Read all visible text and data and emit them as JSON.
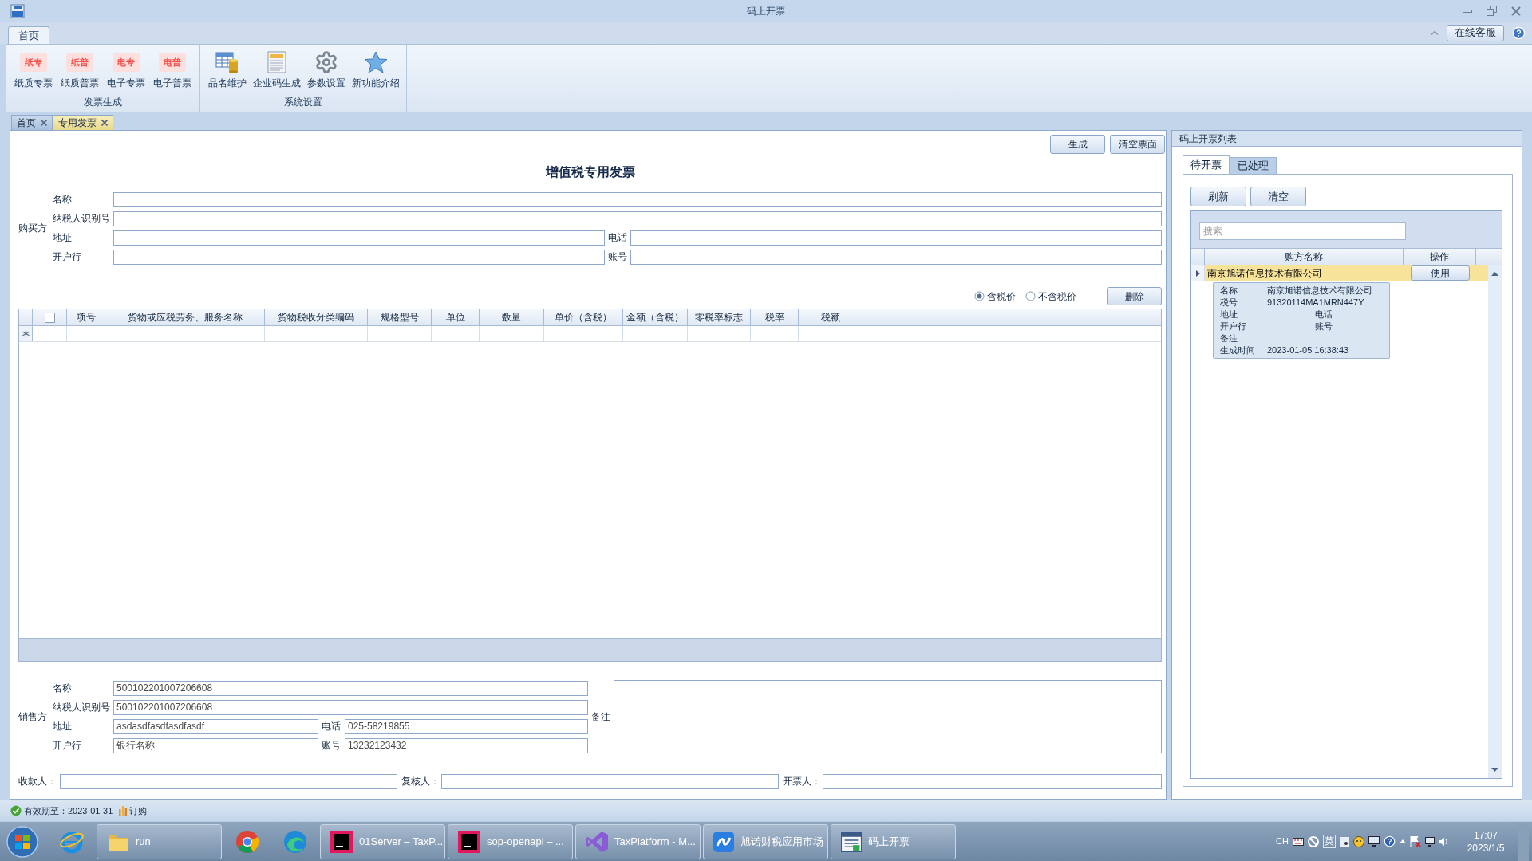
{
  "window": {
    "title": "码上开票"
  },
  "ribbon": {
    "tabs": [
      {
        "label": "首页",
        "selected": true
      }
    ],
    "service_button": "在线客服",
    "groups": [
      {
        "label": "发票生成",
        "items": [
          {
            "kind": "ticket",
            "icon_text": "纸专",
            "label": "纸质专票"
          },
          {
            "kind": "ticket",
            "icon_text": "纸普",
            "label": "纸质普票"
          },
          {
            "kind": "ticket",
            "icon_text": "电专",
            "label": "电子专票"
          },
          {
            "kind": "ticket",
            "icon_text": "电普",
            "label": "电子普票"
          }
        ]
      },
      {
        "label": "系统设置",
        "items": [
          {
            "kind": "table",
            "label": "品名维护"
          },
          {
            "kind": "document",
            "label": "企业码生成"
          },
          {
            "kind": "gear",
            "label": "参数设置"
          },
          {
            "kind": "star",
            "label": "新功能介绍"
          }
        ]
      }
    ]
  },
  "doc_tabs": [
    {
      "label": "首页",
      "selected": false
    },
    {
      "label": "专用发票",
      "selected": true
    }
  ],
  "invoice": {
    "actions": [
      "生成",
      "清空票面"
    ],
    "title": "增值税专用发票",
    "buyer": {
      "label": "购买方",
      "rows": [
        [
          {
            "label": "名称"
          }
        ],
        [
          {
            "label": "纳税人识别号"
          }
        ],
        [
          {
            "label": "地址"
          },
          {
            "label": "电话"
          }
        ],
        [
          {
            "label": "开户行"
          },
          {
            "label": "账号"
          }
        ]
      ]
    },
    "price_modes": [
      {
        "label": "含税价",
        "selected": true
      },
      {
        "label": "不含税价",
        "selected": false
      }
    ],
    "delete_button": "删除",
    "items_table": {
      "select_all": {
        "checked": false
      },
      "columns": [
        "项号",
        "货物或应税劳务、服务名称",
        "货物税收分类编码",
        "规格型号",
        "单位",
        "数量",
        "单价（含税）",
        "金额（含税）",
        "零税率标志",
        "税率",
        "税额"
      ]
    },
    "seller": {
      "label": "销售方",
      "rows": [
        [
          {
            "label": "名称",
            "value": "500102201007206608"
          }
        ],
        [
          {
            "label": "纳税人识别号",
            "value": "500102201007206608"
          }
        ],
        [
          {
            "label": "地址",
            "value": "asdasdfasdfasdfasdf"
          },
          {
            "label": "电话",
            "value": "025-58219855"
          }
        ],
        [
          {
            "label": "开户行",
            "value": "银行名称"
          },
          {
            "label": "账号",
            "value": "13232123432"
          }
        ]
      ],
      "remark_label": "备注"
    },
    "signatures": [
      {
        "label": "收款人："
      },
      {
        "label": "复核人："
      },
      {
        "label": "开票人："
      }
    ]
  },
  "qr_list": {
    "title": "码上开票列表",
    "tabs": [
      {
        "label": "待开票",
        "selected": true
      },
      {
        "label": "已处理",
        "selected": false
      }
    ],
    "buttons": [
      "刷新",
      "清空"
    ],
    "search": {
      "placeholder": "搜索"
    },
    "columns": [
      "购方名称",
      "操作"
    ],
    "rows": [
      {
        "buyer": "南京旭诺信息技术有限公司",
        "action": "使用",
        "selected": true,
        "expanded": true,
        "details": [
          {
            "label": "名称",
            "value": "南京旭诺信息技术有限公司"
          },
          {
            "label": "税号",
            "value": "91320114MA1MRN447Y"
          },
          {
            "label": "地址",
            "extra_label": "电话"
          },
          {
            "label": "开户行",
            "extra_label": "账号"
          },
          {
            "label": "备注"
          },
          {
            "label": "生成时间",
            "value": "2023-01-05 16:38:43"
          }
        ]
      }
    ]
  },
  "status_bar": {
    "expiry": "有效期至：2023-01-31",
    "order": "订购"
  },
  "taskbar": {
    "items": [
      {
        "kind": "start"
      },
      {
        "kind": "browser_e"
      },
      {
        "kind": "folder",
        "label": "run"
      },
      {
        "kind": "browser_chrome"
      },
      {
        "kind": "browser_edge"
      },
      {
        "kind": "ide",
        "label": "01Server – TaxP..."
      },
      {
        "kind": "ide",
        "label": "sop-openapi – ..."
      },
      {
        "kind": "vs",
        "label": "TaxPlatform - M..."
      },
      {
        "kind": "store",
        "label": "旭诺财税应用市场"
      },
      {
        "kind": "invoice",
        "label": "码上开票"
      }
    ],
    "tray": {
      "language": "CH",
      "ime": "英"
    },
    "clock": {
      "time": "17:07",
      "date": "2023/1/5"
    }
  }
}
